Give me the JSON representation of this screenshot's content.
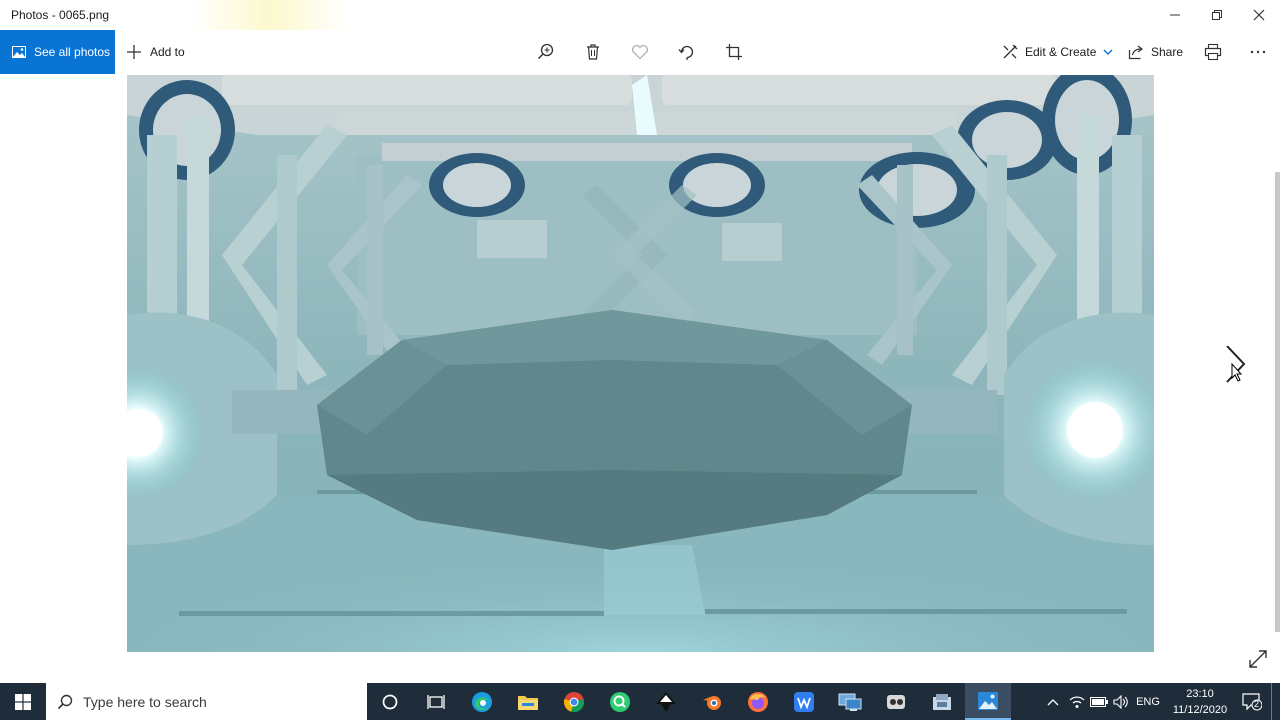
{
  "window": {
    "title": "Photos - 0065.png",
    "controls": [
      "minimize-icon",
      "maximize-icon",
      "close-icon"
    ]
  },
  "toolbar": {
    "see_all_photos": "See all photos",
    "add_to": "Add to",
    "center_icons": [
      "zoom-icon",
      "delete-icon",
      "favorite-heart-icon",
      "rotate-icon",
      "crop-icon"
    ],
    "edit_create": "Edit & Create",
    "share": "Share",
    "right_icons": [
      "print-icon",
      "more-icon"
    ],
    "more_label": "..."
  },
  "viewer": {
    "image": "3D render of sci-fi spaceship interior with glowing lights",
    "nav_icon": "next-arrow-icon",
    "expand_icon": "expand-icon"
  },
  "taskbar": {
    "search_placeholder": "Type here to search",
    "apps": [
      "cortana-icon",
      "task-view-icon",
      "edge-icon",
      "file-explorer-icon",
      "chrome-icon",
      "green-app-icon",
      "inkscape-icon",
      "blender-icon",
      "firefox-icon",
      "wps-writer-icon",
      "remote-desktop-icon",
      "app-icon",
      "app-icon-2",
      "photos-icon"
    ],
    "tray": {
      "language": "ENG",
      "time": "23:10",
      "date": "11/12/2020",
      "notification_count": "2"
    }
  },
  "colors": {
    "accent": "#0a74d4",
    "taskbar": "#1f2d3a",
    "scene": "#7fb0b7"
  }
}
